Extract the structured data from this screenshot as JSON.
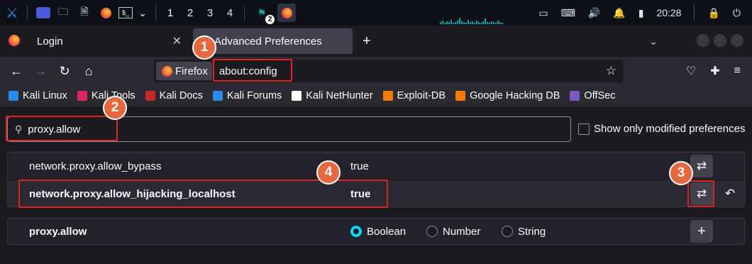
{
  "taskbar": {
    "workspaces": [
      "1",
      "2",
      "3",
      "4"
    ],
    "clock": "20:28",
    "badge_count": "2"
  },
  "tabs": [
    {
      "label": "Login"
    },
    {
      "label": "Advanced Preferences"
    }
  ],
  "nav": {
    "identity_label": "Firefox",
    "url": "about:config"
  },
  "bookmarks": [
    {
      "label": "Kali Linux",
      "color": "#2b8de9"
    },
    {
      "label": "Kali Tools",
      "color": "#e0245e"
    },
    {
      "label": "Kali Docs",
      "color": "#c62828"
    },
    {
      "label": "Kali Forums",
      "color": "#2b8de9"
    },
    {
      "label": "Kali NetHunter",
      "color": "#ffffff"
    },
    {
      "label": "Exploit-DB",
      "color": "#f57c00"
    },
    {
      "label": "Google Hacking DB",
      "color": "#f57c00"
    },
    {
      "label": "OffSec",
      "color": "#7e57c2"
    }
  ],
  "config": {
    "search_value": "proxy.allow",
    "modified_only_label": "Show only modified preferences",
    "rows": [
      {
        "name": "network.proxy.allow_bypass",
        "value": "true"
      },
      {
        "name": "network.proxy.allow_hijacking_localhost",
        "value": "true"
      }
    ],
    "new_pref": {
      "name": "proxy.allow",
      "types": [
        "Boolean",
        "Number",
        "String"
      ],
      "selected": "Boolean"
    }
  },
  "annotations": [
    "1",
    "2",
    "3",
    "4"
  ],
  "colors": {
    "highlight": "#e02424",
    "badge": "#e8673c",
    "accent": "#00ddff"
  }
}
